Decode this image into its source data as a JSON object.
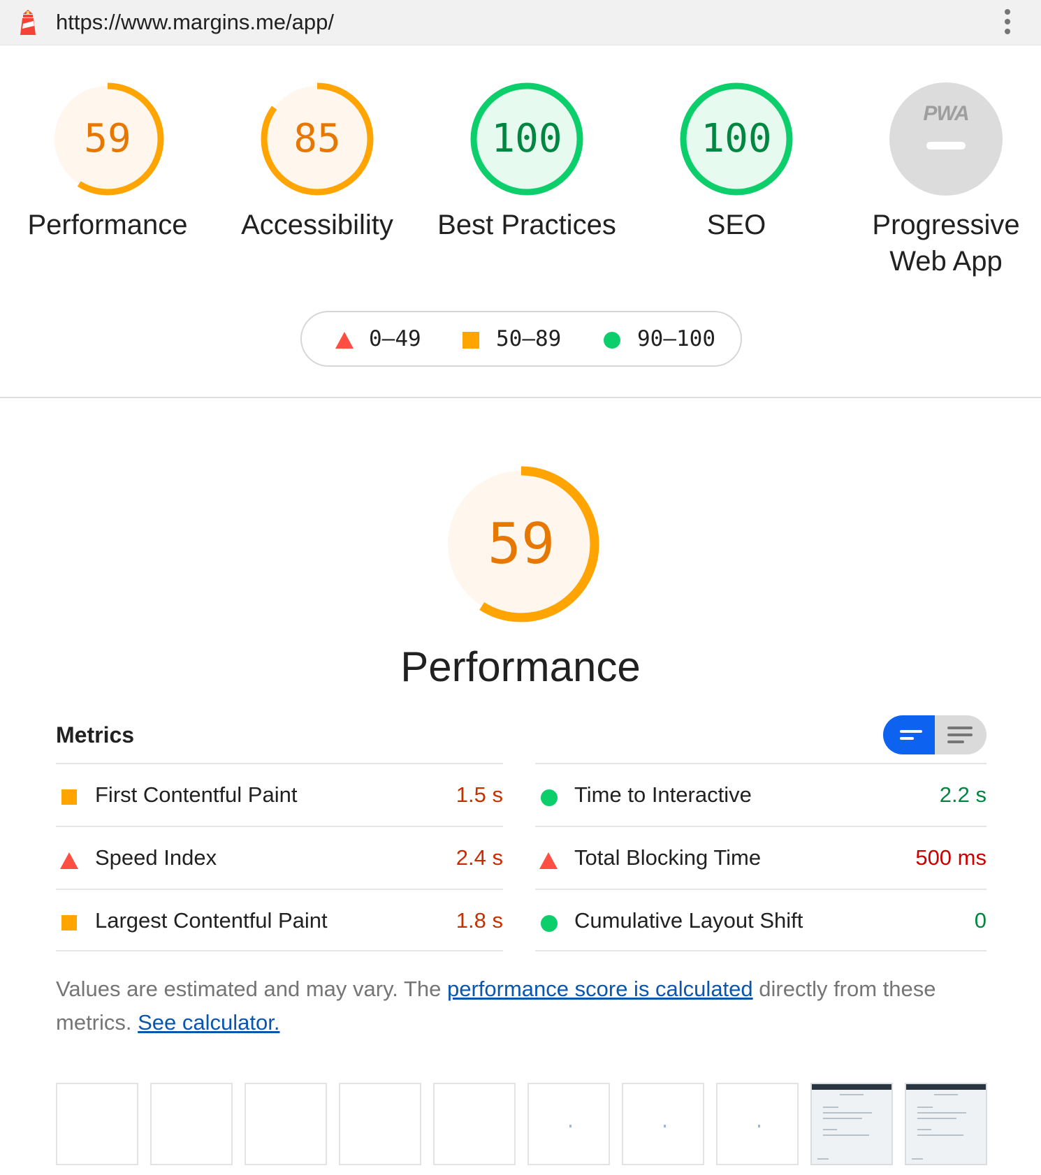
{
  "browser": {
    "url": "https://www.margins.me/app/",
    "logo_icon": "lighthouse-icon",
    "menu_icon": "more-vert-icon"
  },
  "colors": {
    "average": "#ffa400",
    "average_text": "#e67700",
    "average_bg": "#fff6ed",
    "pass": "#0cce6b",
    "pass_text": "#018642",
    "pass_bg": "#e6faf0",
    "fail": "#ff4e42",
    "na_bg": "#dcdcdc",
    "link": "#0b56ad",
    "toggle_active": "#0d62f0"
  },
  "categories": [
    {
      "score": 59,
      "score_text": "59",
      "label": "Performance",
      "rating": "average"
    },
    {
      "score": 85,
      "score_text": "85",
      "label": "Accessibility",
      "rating": "average"
    },
    {
      "score": 100,
      "score_text": "100",
      "label": "Best Practices",
      "rating": "pass"
    },
    {
      "score": 100,
      "score_text": "100",
      "label": "SEO",
      "rating": "pass"
    },
    {
      "score": null,
      "badge_text": "PWA",
      "label_line1": "Progressive",
      "label_line2": "Web App",
      "rating": "na"
    }
  ],
  "legend": [
    {
      "range": "0–49",
      "icon": "triangle-icon"
    },
    {
      "range": "50–89",
      "icon": "square-icon"
    },
    {
      "range": "90–100",
      "icon": "circle-icon"
    }
  ],
  "performance": {
    "score": 59,
    "score_text": "59",
    "title": "Performance",
    "metrics_title": "Metrics",
    "view_toggle": {
      "active": "summary-view",
      "icons": [
        "summary-view-icon",
        "detailed-view-icon"
      ]
    },
    "metrics_left": [
      {
        "label": "First Contentful Paint",
        "value": "1.5 s",
        "rating": "average"
      },
      {
        "label": "Speed Index",
        "value": "2.4 s",
        "rating": "fail"
      },
      {
        "label": "Largest Contentful Paint",
        "value": "1.8 s",
        "rating": "average"
      }
    ],
    "metrics_right": [
      {
        "label": "Time to Interactive",
        "value": "2.2 s",
        "rating": "pass"
      },
      {
        "label": "Total Blocking Time",
        "value": "500 ms",
        "rating": "fail"
      },
      {
        "label": "Cumulative Layout Shift",
        "value": "0",
        "rating": "pass"
      }
    ],
    "note_prefix": "Values are estimated and may vary. The ",
    "note_link1": "performance score is calculated",
    "note_middle": " directly from these metrics. ",
    "note_link2": "See calculator."
  },
  "filmstrip": {
    "frames": 10,
    "blank_frames": 5,
    "loading_frames": 3,
    "rendered_frames": 2
  }
}
